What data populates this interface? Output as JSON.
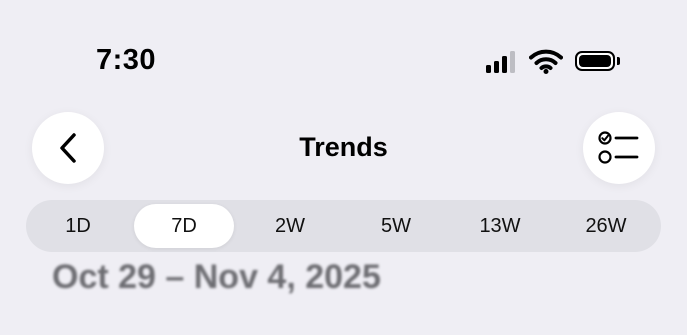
{
  "status_bar": {
    "time": "7:30",
    "icons": [
      "cellular-signal-icon",
      "wifi-icon",
      "battery-icon"
    ]
  },
  "nav": {
    "title": "Trends",
    "back_icon": "chevron-left-icon",
    "options_icon": "checklist-icon"
  },
  "range_picker": {
    "selected": "7D",
    "options": [
      "1D",
      "7D",
      "2W",
      "5W",
      "13W",
      "26W"
    ]
  },
  "date_range": "Oct 29 – Nov 4, 2025",
  "colors": {
    "background": "#efeef4",
    "segment_track": "#e0e0e6",
    "segment_selected": "#ffffff",
    "date_text": "#6d6d72"
  }
}
